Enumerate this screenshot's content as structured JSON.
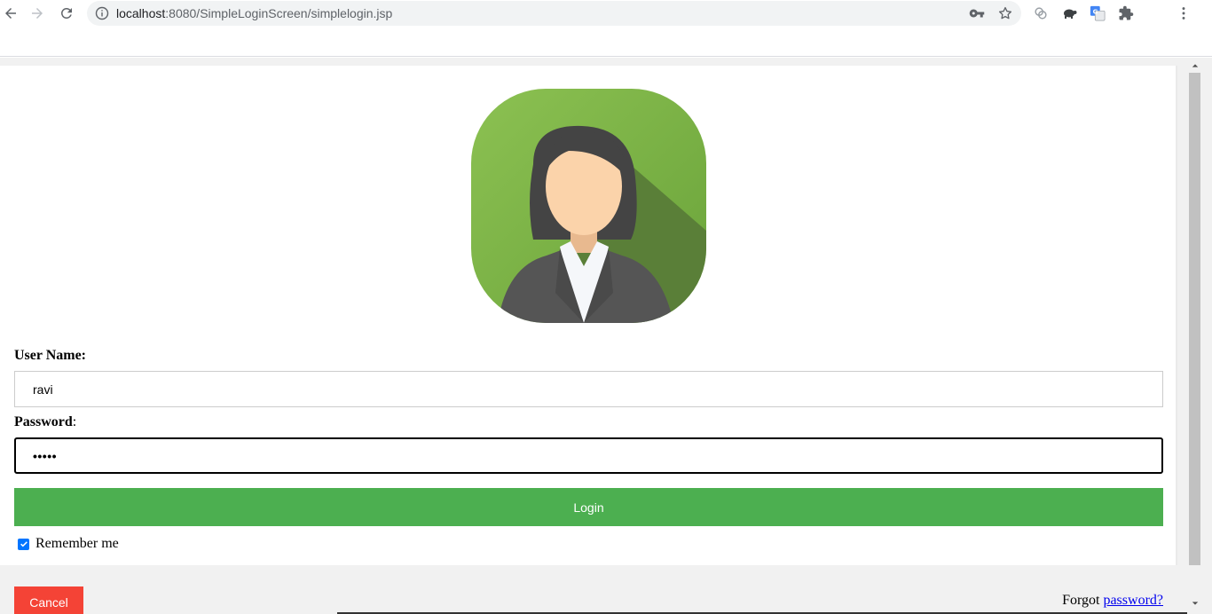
{
  "browser": {
    "url_host": "localhost",
    "url_rest": ":8080/SimpleLoginScreen/simplelogin.jsp",
    "icons": [
      "back-arrow-icon",
      "forward-arrow-icon",
      "reload-icon",
      "info-icon",
      "key-icon",
      "star-icon",
      "extension-icon",
      "turtle-icon",
      "translate-icon",
      "puzzle-icon",
      "more-vert-icon"
    ]
  },
  "form": {
    "username_label": "User Name:",
    "username_value": "ravi",
    "password_label": "Password",
    "password_colon": ":",
    "password_mask": "•••••",
    "login_label": "Login",
    "remember_label": "Remember me",
    "remember_checked": true,
    "cancel_label": "Cancel",
    "forgot_prefix": "Forgot ",
    "forgot_link": "password?"
  },
  "colors": {
    "login_button": "#4caf50",
    "cancel_button": "#f44336",
    "avatar_background": "#8bc34a",
    "link": "#0000ee"
  }
}
